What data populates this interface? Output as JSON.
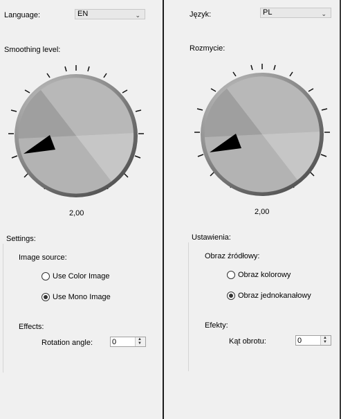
{
  "left": {
    "language_label": "Language:",
    "language_value": "EN",
    "smoothing_label": "Smoothing level:",
    "knob_value": "2,00",
    "settings_label": "Settings:",
    "image_source_label": "Image source:",
    "radio_color": "Use Color Image",
    "radio_mono": "Use Mono Image",
    "selected": "mono",
    "effects_label": "Effects:",
    "rotation_label": "Rotation angle:",
    "rotation_value": "0"
  },
  "right": {
    "language_label": "Język:",
    "language_value": "PL",
    "smoothing_label": "Rozmycie:",
    "knob_value": "2,00",
    "settings_label": "Ustawienia:",
    "image_source_label": "Obraz źródłowy:",
    "radio_color": "Obraz kolorowy",
    "radio_mono": "Obraz jednokanałowy",
    "selected": "mono",
    "effects_label": "Efekty:",
    "rotation_label": "Kąt obrotu:",
    "rotation_value": "0"
  },
  "icons": {
    "dropdown": "chevron-down-icon",
    "spin_up": "spin-up-icon",
    "spin_down": "spin-down-icon"
  }
}
